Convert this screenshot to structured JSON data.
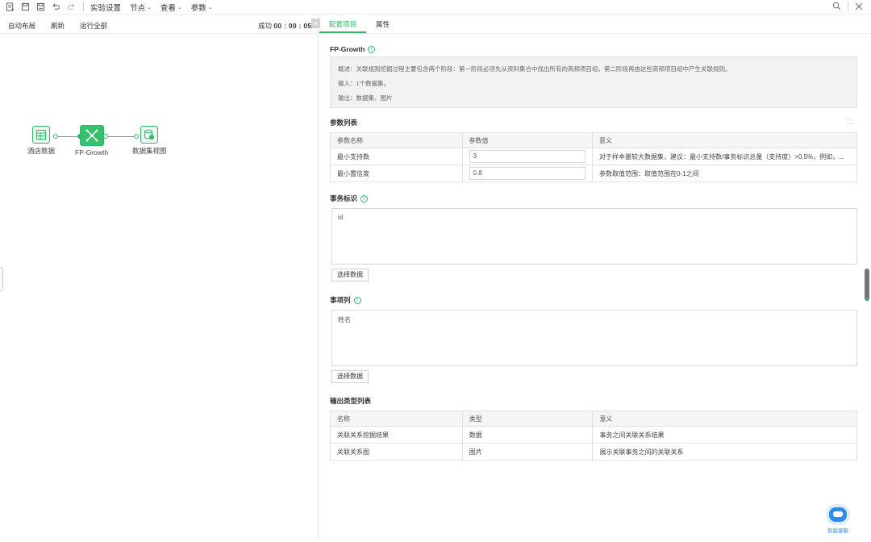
{
  "toolbar": {
    "icons": [
      "new-icon",
      "save-icon",
      "save-as-icon",
      "undo-icon",
      "redo-icon"
    ],
    "menus": [
      {
        "label": "实验设置",
        "caret": false
      },
      {
        "label": "节点",
        "caret": true
      },
      {
        "label": "查看",
        "caret": true
      },
      {
        "label": "参数",
        "caret": true
      }
    ]
  },
  "left": {
    "actions": [
      "自动布局",
      "刷新",
      "运行全部"
    ],
    "status_prefix": "成功",
    "status_time": "00 : 00 : 05",
    "nodes": [
      {
        "label": "酒店数据",
        "icon": "data-table-icon"
      },
      {
        "label": "FP-Growth",
        "icon": "fp-growth-icon"
      },
      {
        "label": "数据集视图",
        "icon": "dataset-view-icon"
      }
    ]
  },
  "tabs": [
    "配置项目",
    "属性"
  ],
  "active_tab": 0,
  "algorithm": {
    "title": "FP-Growth",
    "description": [
      "概述：关联规则挖掘过程主要包含两个阶段：第一阶段必须先从资料集合中找出所有的高频项目组，第二阶段再由这些高频项目组中产生关联规则。",
      "输入：1个数据集。",
      "输出：数据集、图片"
    ]
  },
  "params": {
    "title": "参数列表",
    "headers": [
      "参数名称",
      "参数值",
      "意义"
    ],
    "rows": [
      {
        "name": "最小支持数",
        "value": "3",
        "meaning": "对于样本量较大数据集，建议：最小支持数/事务标识总量（支持度）>0.5%，例如，..."
      },
      {
        "name": "最小置信度",
        "value": "0.8",
        "meaning": "参数取值范围：取值范围在0-1之间"
      }
    ]
  },
  "transaction_id": {
    "title": "事务标识",
    "value": "id",
    "button": "选择数据"
  },
  "item_column": {
    "title": "事项列",
    "value": "姓名",
    "button": "选择数据"
  },
  "outputs": {
    "title": "输出类型列表",
    "headers": [
      "名称",
      "类型",
      "意义"
    ],
    "rows": [
      {
        "name": "关联关系挖掘结果",
        "type": "数据",
        "meaning": "事务之间关联关系结果"
      },
      {
        "name": "关联关系图",
        "type": "图片",
        "meaning": "展示关联事务之间的关联关系"
      }
    ]
  },
  "assistant": {
    "label": "智能客服"
  },
  "colors": {
    "accent": "#2eb867",
    "assistant": "#2f8de8"
  }
}
